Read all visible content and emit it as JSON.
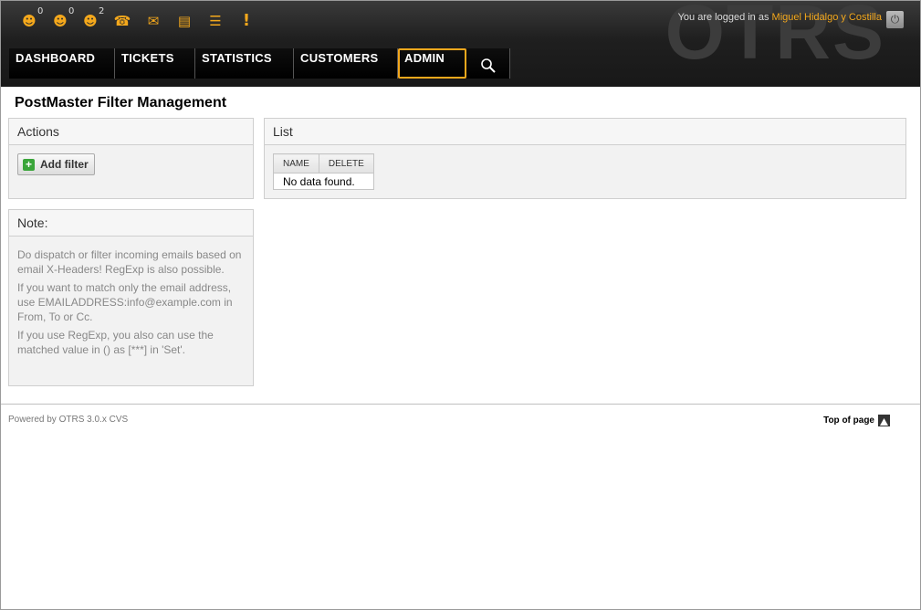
{
  "header": {
    "watermark": "OTRS",
    "login_text": "You are logged in as",
    "user_name": "Miguel Hidalgo y Costilla",
    "toolbar": [
      {
        "name": "locked-tickets-icon",
        "glyph": "☻",
        "count": "0"
      },
      {
        "name": "watched-tickets-icon",
        "glyph": "☻",
        "count": "0"
      },
      {
        "name": "responsible-tickets-icon",
        "glyph": "☻",
        "count": "2"
      },
      {
        "name": "new-phone-ticket-icon",
        "glyph": "☎",
        "count": ""
      },
      {
        "name": "new-email-ticket-icon",
        "glyph": "✉",
        "count": ""
      },
      {
        "name": "queue-view-icon",
        "glyph": "▤",
        "count": ""
      },
      {
        "name": "status-view-icon",
        "glyph": "☰",
        "count": ""
      },
      {
        "name": "escalation-view-icon",
        "glyph": "!",
        "count": ""
      }
    ],
    "nav": [
      {
        "label": "DASHBOARD",
        "width": 116
      },
      {
        "label": "TICKETS",
        "width": 88
      },
      {
        "label": "STATISTICS",
        "width": 108
      },
      {
        "label": "CUSTOMERS",
        "width": 114
      },
      {
        "label": "ADMIN",
        "width": 75,
        "active": true
      }
    ]
  },
  "main": {
    "title": "PostMaster Filter Management",
    "actions": {
      "heading": "Actions",
      "add_filter_label": "Add filter"
    },
    "list": {
      "heading": "List",
      "columns": [
        "NAME",
        "DELETE"
      ],
      "empty_text": "No data found."
    },
    "note": {
      "heading": "Note:",
      "paragraphs": [
        "Do dispatch or filter incoming emails based on email X-Headers! RegExp is also possible.",
        "If you want to match only the email address, use EMAILADDRESS:info@example.com in From, To or Cc.",
        "If you use RegExp, you also can use the matched value in () as [***] in 'Set'."
      ]
    }
  },
  "footer": {
    "powered_by": "Powered by OTRS 3.0.x CVS",
    "top_of_page": "Top of page"
  },
  "colors": {
    "accent": "#f4a81c",
    "header_bg": "#1f1f1f"
  }
}
